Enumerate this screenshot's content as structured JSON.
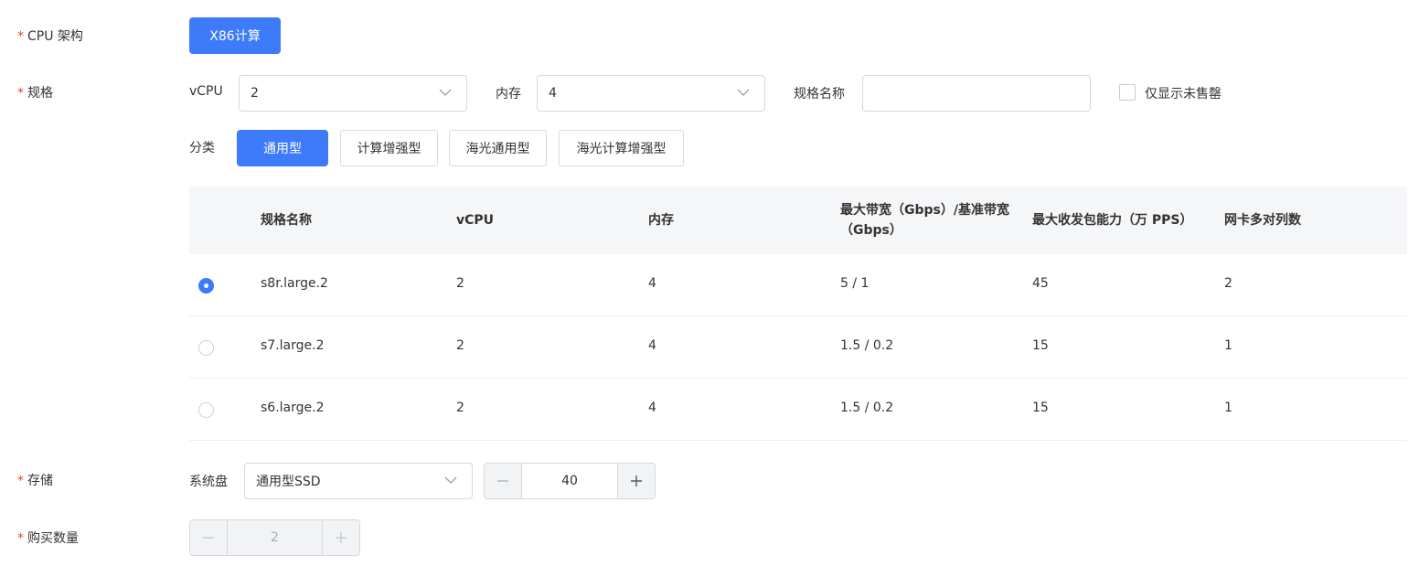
{
  "form": {
    "required_mark": "*",
    "cpu_arch": {
      "label": "CPU 架构",
      "option": "X86计算"
    },
    "spec": {
      "label": "规格",
      "vcpu_label": "vCPU",
      "vcpu_value": "2",
      "memory_label": "内存",
      "memory_value": "4",
      "name_label": "规格名称",
      "name_value": "",
      "only_unsold_label": "仅显示未售罄",
      "category_label": "分类",
      "categories": [
        "通用型",
        "计算增强型",
        "海光通用型",
        "海光计算增强型"
      ],
      "selected_category": "通用型"
    },
    "table": {
      "headers": [
        "规格名称",
        "vCPU",
        "内存",
        "最大带宽（Gbps）/基准带宽（Gbps）",
        "最大收发包能力（万 PPS）",
        "网卡多对列数"
      ],
      "rows": [
        {
          "selected": true,
          "name": "s8r.large.2",
          "vcpu": "2",
          "memory": "4",
          "bandwidth": "5 / 1",
          "pps": "45",
          "queues": "2"
        },
        {
          "selected": false,
          "name": "s7.large.2",
          "vcpu": "2",
          "memory": "4",
          "bandwidth": "1.5 / 0.2",
          "pps": "15",
          "queues": "1"
        },
        {
          "selected": false,
          "name": "s6.large.2",
          "vcpu": "2",
          "memory": "4",
          "bandwidth": "1.5 / 0.2",
          "pps": "15",
          "queues": "1"
        }
      ]
    },
    "storage": {
      "label": "存储",
      "disk_label": "系统盘",
      "disk_type": "通用型SSD",
      "size": "40"
    },
    "quantity": {
      "label": "购买数量",
      "value": "2"
    }
  },
  "colors": {
    "primary": "#3e7bfa",
    "required": "#e5433b",
    "header_bg": "#f5f6f8"
  }
}
